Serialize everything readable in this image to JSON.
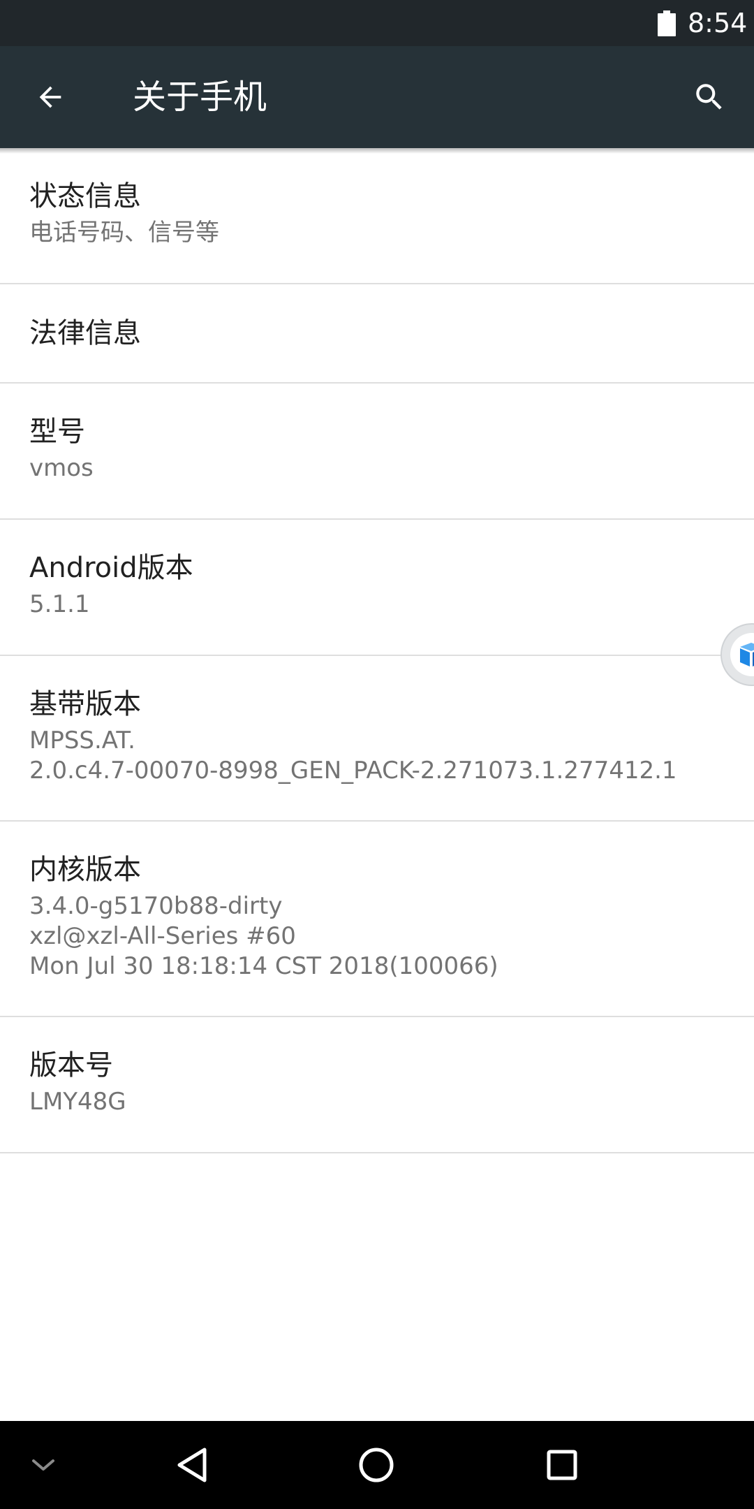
{
  "status_bar": {
    "time": "8:54",
    "battery_icon": "battery-full-icon"
  },
  "toolbar": {
    "title": "关于手机",
    "back_icon": "arrow-back-icon",
    "search_icon": "search-icon",
    "background": "#263238"
  },
  "items": [
    {
      "title": "状态信息",
      "summary": [
        "电话号码、信号等"
      ]
    },
    {
      "title": "法律信息",
      "summary": []
    },
    {
      "title": "型号",
      "summary": [
        "vmos"
      ]
    },
    {
      "title": "Android版本",
      "summary": [
        "5.1.1"
      ]
    },
    {
      "title": "基带版本",
      "summary": [
        "MPSS.AT.",
        "2.0.c4.7-00070-8998_GEN_PACK-2.271073.1.277412.1"
      ]
    },
    {
      "title": "内核版本",
      "summary": [
        "3.4.0-g5170b88-dirty",
        "xzl@xzl-All-Series #60",
        "Mon Jul 30 18:18:14 CST 2018(100066)"
      ]
    },
    {
      "title": "版本号",
      "summary": [
        "LMY48G"
      ]
    }
  ],
  "floating_button": {
    "icon": "cube-icon",
    "accent": "#1e88e5"
  },
  "nav_bar": {
    "collapse_icon": "chevron-down-icon",
    "back_icon": "nav-back-triangle-icon",
    "home_icon": "nav-home-circle-icon",
    "recents_icon": "nav-recents-square-icon"
  }
}
